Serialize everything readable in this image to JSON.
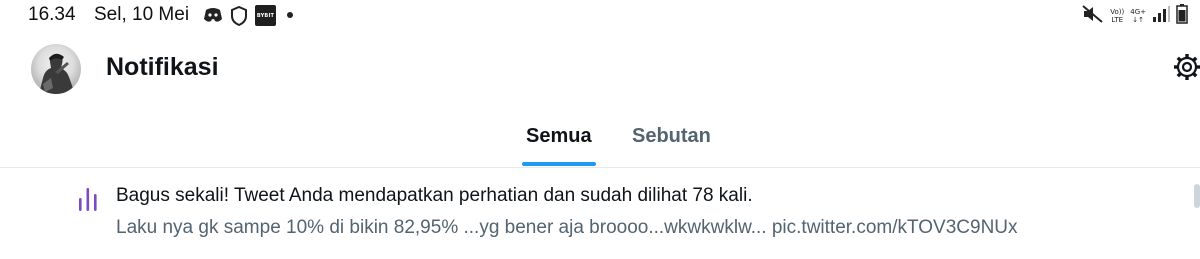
{
  "status_bar": {
    "time": "16.34",
    "date": "Sel, 10 Mei",
    "bybit_label": "BYBIT",
    "network_top": "Vo))",
    "network_bottom": "LTE",
    "network_gen": "4G+",
    "icons": [
      "discord-icon",
      "shield-icon",
      "bybit-app-icon",
      "notification-dot",
      "mute-icon",
      "volte-icon",
      "4g-icon",
      "signal-icon",
      "battery-icon"
    ]
  },
  "header": {
    "title": "Notifikasi",
    "settings_icon": "gear-icon"
  },
  "tabs": [
    {
      "label": "Semua",
      "active": true
    },
    {
      "label": "Sebutan",
      "active": false
    }
  ],
  "notifications": [
    {
      "icon": "analytics-bars-icon",
      "title": "Bagus sekali! Tweet Anda mendapatkan perhatian dan sudah dilihat 78 kali.",
      "snippet": "Laku nya gk sampe 10% di bikin 82,95% ...yg bener aja broooo...wkwkwklw... pic.twitter.com/kTOV3C9NUx"
    }
  ],
  "colors": {
    "accent": "#1d9bf0",
    "primary_text": "#0f1419",
    "secondary_text": "#536471",
    "analytics_icon": "#794bc4"
  }
}
